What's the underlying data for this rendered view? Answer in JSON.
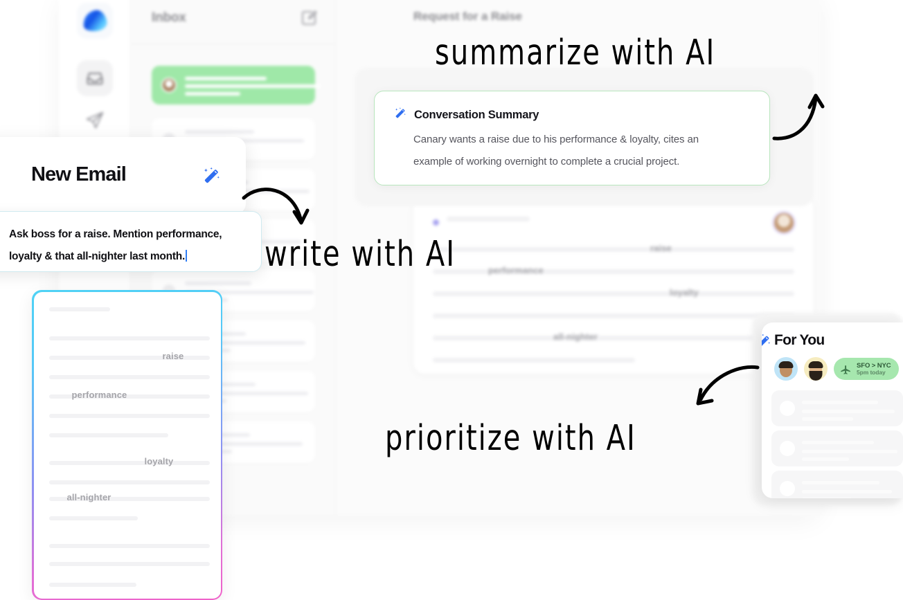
{
  "app": {
    "logo_icon": "canary-bird-logo",
    "rail_items": [
      {
        "name": "logo",
        "icon": "bird-logo-icon"
      },
      {
        "name": "inbox",
        "icon": "inbox-tray-icon"
      },
      {
        "name": "sent",
        "icon": "paper-plane-icon"
      }
    ]
  },
  "list_pane": {
    "title": "Inbox",
    "compose_icon": "compose-pencil-icon",
    "rows": [
      {
        "state": "selected"
      },
      {
        "state": "default"
      },
      {
        "state": "default"
      },
      {
        "state": "default"
      },
      {
        "state": "default"
      },
      {
        "state": "default"
      },
      {
        "state": "default"
      },
      {
        "state": "default"
      }
    ]
  },
  "detail": {
    "title": "Request for a Raise",
    "summary": {
      "icon": "magic-wand-icon",
      "title": "Conversation Summary",
      "line1": "Canary wants a raise due to his performance & loyalty, cites an",
      "line2": "example of working overnight to complete a crucial project."
    },
    "thread": {
      "avatar": "sender-avatar",
      "keywords": [
        "raise",
        "performance",
        "loyalty",
        "all-nighter"
      ]
    }
  },
  "compose": {
    "title": "New Email",
    "wand_icon": "magic-wand-icon",
    "prompt_line1": "Ask boss for a raise. Mention performance,",
    "prompt_line2": "loyalty & that all-nighter last month.",
    "caret": "text-cursor"
  },
  "draft": {
    "keywords": [
      "raise",
      "performance",
      "loyalty",
      "all-nighter"
    ],
    "border_gradient": [
      "#4fd2f5",
      "#8f8ff2",
      "#f062c9"
    ]
  },
  "for_you": {
    "title": "For You",
    "wand_icon": "magic-wand-icon",
    "avatars": [
      "memoji-person-1",
      "memoji-person-2"
    ],
    "flight_chip": {
      "icon": "airplane-icon",
      "route": "SFO > NYC",
      "time": "5pm today"
    },
    "rows": [
      {},
      {},
      {}
    ]
  },
  "annotations": {
    "summarize": "summarize with AI",
    "write": "write with AI",
    "prioritize": "prioritize with AI"
  },
  "colors": {
    "accent_blue": "#2f6ef0",
    "selected_green": "#9fe8a8",
    "summary_border": "#b8e6bd",
    "prompt_border": "#cfeaf0"
  }
}
